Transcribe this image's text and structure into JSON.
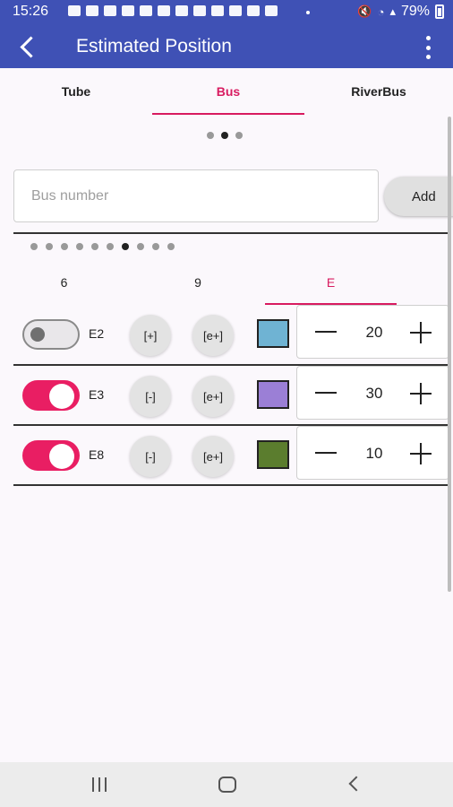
{
  "status_bar": {
    "time": "15:26",
    "battery": "79%"
  },
  "app_bar": {
    "title": "Estimated Position"
  },
  "main_tabs": [
    {
      "label": "Tube",
      "active": false
    },
    {
      "label": "Bus",
      "active": true
    },
    {
      "label": "RiverBus",
      "active": false
    }
  ],
  "pager": {
    "count": 3,
    "active_index": 1
  },
  "search": {
    "placeholder": "Bus number",
    "value": ""
  },
  "add_button": {
    "label": "Add"
  },
  "sub_pager": {
    "count": 10,
    "active_index": 6
  },
  "sub_tabs": [
    {
      "label": "6",
      "active": false
    },
    {
      "label": "9",
      "active": false
    },
    {
      "label": "E",
      "active": true
    }
  ],
  "routes": [
    {
      "name": "E2",
      "enabled": false,
      "toggle_label": "[+]",
      "extra_label": "[e+]",
      "color": "#6fb3d3",
      "count": "20"
    },
    {
      "name": "E3",
      "enabled": true,
      "toggle_label": "[-]",
      "extra_label": "[e+]",
      "color": "#9b7fd6",
      "count": "30"
    },
    {
      "name": "E8",
      "enabled": true,
      "toggle_label": "[-]",
      "extra_label": "[e+]",
      "color": "#5b7d2e",
      "count": "10"
    }
  ],
  "colors": {
    "primary": "#3f51b5",
    "accent": "#d81b60",
    "switch_on": "#e91e63"
  }
}
